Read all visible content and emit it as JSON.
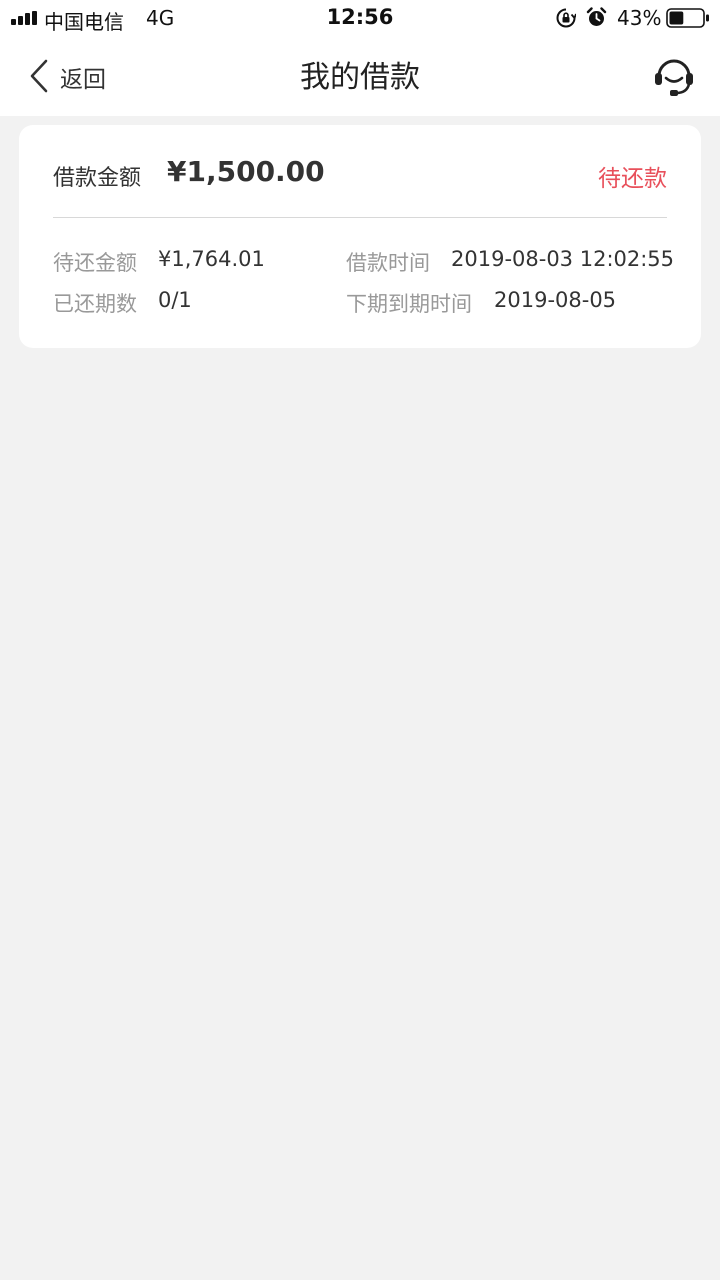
{
  "status_bar": {
    "carrier": "中国电信",
    "network": "4G",
    "time": "12:56",
    "battery_percent": "43%",
    "battery_level": 0.43,
    "icons": [
      "signal-icon",
      "rotation-lock-icon",
      "alarm-icon",
      "battery-icon"
    ]
  },
  "nav": {
    "back_label": "返回",
    "title": "我的借款",
    "right_icon": "customer-service-icon"
  },
  "loan": {
    "amount_label": "借款金额",
    "amount_value": "¥1,500.00",
    "status": "待还款",
    "status_color": "#e8505b",
    "details": {
      "pending_label": "待还金额",
      "pending_value": "¥1,764.01",
      "loan_time_label": "借款时间",
      "loan_time_value": "2019-08-03 12:02:55",
      "repaid_label": "已还期数",
      "repaid_value": "0/1",
      "due_label": "下期到期时间",
      "due_value": "2019-08-05"
    }
  }
}
